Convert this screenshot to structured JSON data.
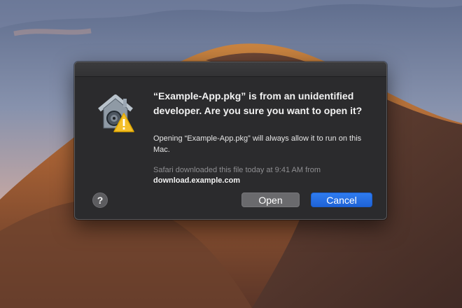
{
  "dialog": {
    "title": "“Example-App.pkg”  is from an unidentified developer. Are you sure you want to open it?",
    "body": "Opening “Example-App.pkg” will always allow it to run on this Mac.",
    "source_line": "Safari downloaded this file today at 9:41 AM from",
    "source_host": "download.example.com",
    "help_label": "?",
    "open_label": "Open",
    "cancel_label": "Cancel"
  },
  "icons": {
    "app": "gatekeeper-house-icon",
    "warning": "warning-triangle-icon"
  },
  "colors": {
    "dialog_background": "#2b2b2d",
    "accent": "#1f63d6",
    "warning": "#f4bf2a"
  }
}
